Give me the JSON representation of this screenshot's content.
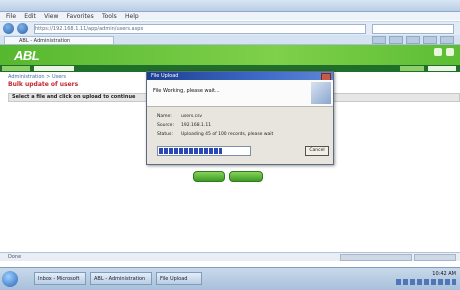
{
  "browser": {
    "menu": [
      "File",
      "Edit",
      "View",
      "Favorites",
      "Tools",
      "Help"
    ],
    "address": "https://192.168.1.11/app/admin/users.aspx",
    "tab_title": "ABL - Administration"
  },
  "app": {
    "logo": "ABL",
    "breadcrumb": "Administration > Users",
    "page_title": "Bulk update of users",
    "grid_header": "Select a file and click on upload to continue"
  },
  "dialog": {
    "title": "File Upload",
    "heading": "File Working, please wait...",
    "rows": [
      {
        "label": "Name:",
        "value": "users.csv"
      },
      {
        "label": "Source:",
        "value": "192.168.1.11"
      },
      {
        "label": "Status:",
        "value": "Uploading 45 of 100 records, please wait"
      }
    ],
    "progress": 0.7,
    "cancel_label": "Cancel"
  },
  "buttons": {
    "upload_label": "Upload",
    "cancel_label": "Cancel"
  },
  "status": {
    "left": "Done",
    "zone": "Internet | Protected Mode: On",
    "zoom": "100%"
  },
  "taskbar": {
    "items": [
      "Inbox - Microsoft",
      "ABL - Administration",
      "File Upload"
    ],
    "clock": "10:42 AM"
  },
  "colors": {
    "header_green": "#56b82f",
    "nav_dark_green": "#1f6f2a",
    "progress_blue": "#2a48b8",
    "title_red": "#c5262c"
  }
}
